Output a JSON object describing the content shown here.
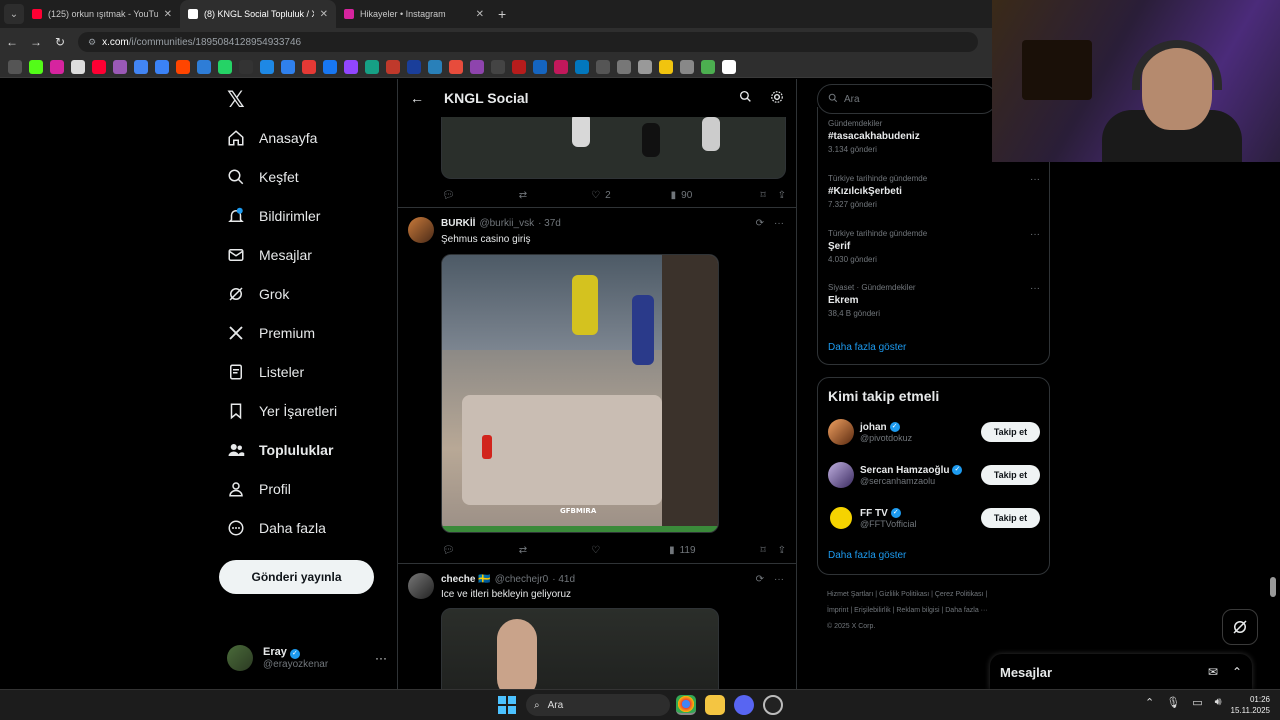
{
  "browser": {
    "tabs": [
      {
        "title": "(125) orkun ışıtmak - YouTube",
        "color": "#ff0033"
      },
      {
        "title": "(8) KNGL Social Topluluk / X",
        "color": "#000000"
      },
      {
        "title": "Hikayeler • Instagram",
        "color": "#d6249f"
      }
    ],
    "url_host": "x.com",
    "url_path": "/i/communities/1895084128954933746"
  },
  "leftnav": {
    "items": [
      {
        "label": "Anasayfa",
        "icon": "home-icon"
      },
      {
        "label": "Keşfet",
        "icon": "search-icon"
      },
      {
        "label": "Bildirimler",
        "icon": "bell-icon"
      },
      {
        "label": "Mesajlar",
        "icon": "mail-icon"
      },
      {
        "label": "Grok",
        "icon": "grok-icon"
      },
      {
        "label": "Premium",
        "icon": "x-icon"
      },
      {
        "label": "Listeler",
        "icon": "list-icon"
      },
      {
        "label": "Yer İşaretleri",
        "icon": "bookmark-icon"
      },
      {
        "label": "Topluluklar",
        "icon": "communities-icon"
      },
      {
        "label": "Profil",
        "icon": "profile-icon"
      },
      {
        "label": "Daha fazla",
        "icon": "more-icon"
      }
    ],
    "post_button": "Gönderi yayınla",
    "account": {
      "name": "Eray",
      "handle": "@erayozkenar"
    }
  },
  "header": {
    "title": "KNGL Social"
  },
  "top_post_actions": {
    "replies": "",
    "retweets": "",
    "likes": "2",
    "views": "90"
  },
  "tweets": [
    {
      "name": "BURKİİ",
      "handle": "@burkii_vsk",
      "time": "· 37d",
      "text": "Şehmus casino giriş",
      "media_caption": "GFBMIRA",
      "actions": {
        "likes": "",
        "views": "119"
      }
    },
    {
      "name": "cheche 🇸🇪",
      "handle": "@chechejr0",
      "time": "· 41d",
      "text": "Ice ve itleri bekleyin geliyoruz"
    }
  ],
  "right": {
    "search_placeholder": "Ara",
    "trends": [
      {
        "category": "Gündemdekiler",
        "name": "#tasacakhabudeniz",
        "count": "3.134 gönderi"
      },
      {
        "category": "Türkiye tarihinde gündemde",
        "name": "#KızılcıkŞerbeti",
        "count": "7.327 gönderi"
      },
      {
        "category": "Türkiye tarihinde gündemde",
        "name": "Şerif",
        "count": "4.030 gönderi"
      },
      {
        "category": "Siyaset · Gündemdekiler",
        "name": "Ekrem",
        "count": "38,4 B gönderi"
      }
    ],
    "show_more": "Daha fazla göster",
    "wtf_title": "Kimi takip etmeli",
    "who_to_follow": [
      {
        "name": "johan",
        "handle": "@pivotdokuz",
        "button": "Takip et"
      },
      {
        "name": "Sercan Hamzaoğlu",
        "handle": "@sercanhamzaolu",
        "button": "Takip et"
      },
      {
        "name": "FF TV",
        "handle": "@FFTVofficial",
        "button": "Takip et"
      }
    ],
    "wtf_show_more": "Daha fazla göster",
    "footer": {
      "line1": "Hizmet Şartları  |  Gizlilik Politikası  |  Çerez Politikası  |",
      "line2": "İmprint  |  Erişilebilirlik  |  Reklam bilgisi  |  Daha fazla ···",
      "line3": "© 2025 X Corp."
    }
  },
  "messages_drawer": {
    "title": "Mesajlar"
  },
  "taskbar": {
    "search": "Ara",
    "time": "01:26",
    "date": "15.11.2025"
  },
  "colors": {
    "accent": "#1d9bf0",
    "background": "#000000"
  }
}
